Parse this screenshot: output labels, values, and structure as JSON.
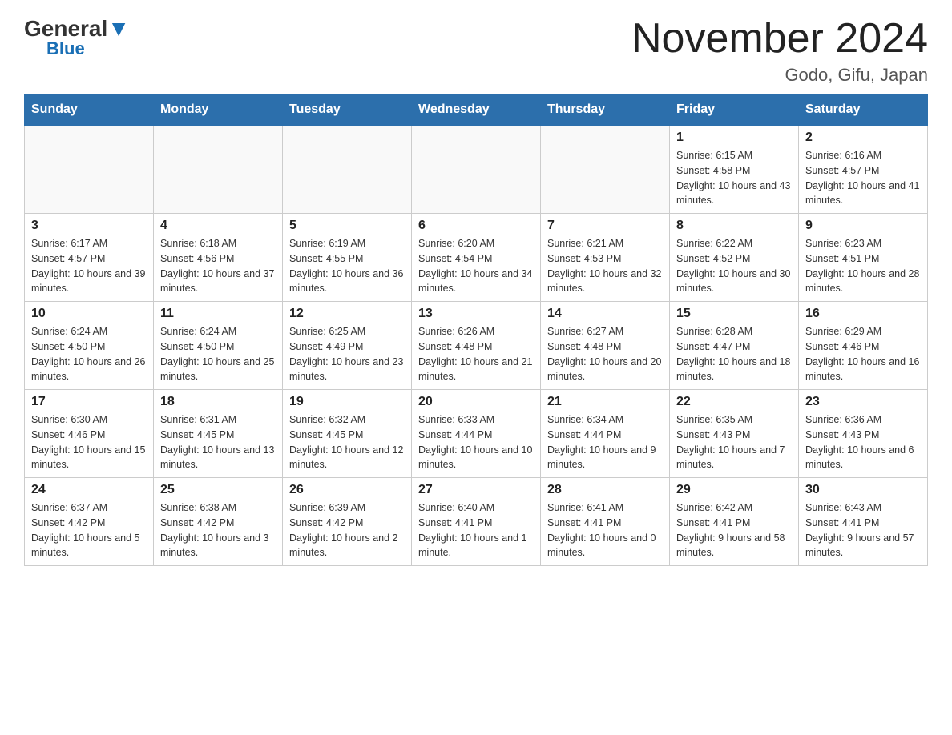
{
  "header": {
    "logo_general": "General",
    "logo_blue": "Blue",
    "month_title": "November 2024",
    "location": "Godo, Gifu, Japan"
  },
  "days_of_week": [
    "Sunday",
    "Monday",
    "Tuesday",
    "Wednesday",
    "Thursday",
    "Friday",
    "Saturday"
  ],
  "weeks": [
    [
      {
        "day": "",
        "info": ""
      },
      {
        "day": "",
        "info": ""
      },
      {
        "day": "",
        "info": ""
      },
      {
        "day": "",
        "info": ""
      },
      {
        "day": "",
        "info": ""
      },
      {
        "day": "1",
        "info": "Sunrise: 6:15 AM\nSunset: 4:58 PM\nDaylight: 10 hours and 43 minutes."
      },
      {
        "day": "2",
        "info": "Sunrise: 6:16 AM\nSunset: 4:57 PM\nDaylight: 10 hours and 41 minutes."
      }
    ],
    [
      {
        "day": "3",
        "info": "Sunrise: 6:17 AM\nSunset: 4:57 PM\nDaylight: 10 hours and 39 minutes."
      },
      {
        "day": "4",
        "info": "Sunrise: 6:18 AM\nSunset: 4:56 PM\nDaylight: 10 hours and 37 minutes."
      },
      {
        "day": "5",
        "info": "Sunrise: 6:19 AM\nSunset: 4:55 PM\nDaylight: 10 hours and 36 minutes."
      },
      {
        "day": "6",
        "info": "Sunrise: 6:20 AM\nSunset: 4:54 PM\nDaylight: 10 hours and 34 minutes."
      },
      {
        "day": "7",
        "info": "Sunrise: 6:21 AM\nSunset: 4:53 PM\nDaylight: 10 hours and 32 minutes."
      },
      {
        "day": "8",
        "info": "Sunrise: 6:22 AM\nSunset: 4:52 PM\nDaylight: 10 hours and 30 minutes."
      },
      {
        "day": "9",
        "info": "Sunrise: 6:23 AM\nSunset: 4:51 PM\nDaylight: 10 hours and 28 minutes."
      }
    ],
    [
      {
        "day": "10",
        "info": "Sunrise: 6:24 AM\nSunset: 4:50 PM\nDaylight: 10 hours and 26 minutes."
      },
      {
        "day": "11",
        "info": "Sunrise: 6:24 AM\nSunset: 4:50 PM\nDaylight: 10 hours and 25 minutes."
      },
      {
        "day": "12",
        "info": "Sunrise: 6:25 AM\nSunset: 4:49 PM\nDaylight: 10 hours and 23 minutes."
      },
      {
        "day": "13",
        "info": "Sunrise: 6:26 AM\nSunset: 4:48 PM\nDaylight: 10 hours and 21 minutes."
      },
      {
        "day": "14",
        "info": "Sunrise: 6:27 AM\nSunset: 4:48 PM\nDaylight: 10 hours and 20 minutes."
      },
      {
        "day": "15",
        "info": "Sunrise: 6:28 AM\nSunset: 4:47 PM\nDaylight: 10 hours and 18 minutes."
      },
      {
        "day": "16",
        "info": "Sunrise: 6:29 AM\nSunset: 4:46 PM\nDaylight: 10 hours and 16 minutes."
      }
    ],
    [
      {
        "day": "17",
        "info": "Sunrise: 6:30 AM\nSunset: 4:46 PM\nDaylight: 10 hours and 15 minutes."
      },
      {
        "day": "18",
        "info": "Sunrise: 6:31 AM\nSunset: 4:45 PM\nDaylight: 10 hours and 13 minutes."
      },
      {
        "day": "19",
        "info": "Sunrise: 6:32 AM\nSunset: 4:45 PM\nDaylight: 10 hours and 12 minutes."
      },
      {
        "day": "20",
        "info": "Sunrise: 6:33 AM\nSunset: 4:44 PM\nDaylight: 10 hours and 10 minutes."
      },
      {
        "day": "21",
        "info": "Sunrise: 6:34 AM\nSunset: 4:44 PM\nDaylight: 10 hours and 9 minutes."
      },
      {
        "day": "22",
        "info": "Sunrise: 6:35 AM\nSunset: 4:43 PM\nDaylight: 10 hours and 7 minutes."
      },
      {
        "day": "23",
        "info": "Sunrise: 6:36 AM\nSunset: 4:43 PM\nDaylight: 10 hours and 6 minutes."
      }
    ],
    [
      {
        "day": "24",
        "info": "Sunrise: 6:37 AM\nSunset: 4:42 PM\nDaylight: 10 hours and 5 minutes."
      },
      {
        "day": "25",
        "info": "Sunrise: 6:38 AM\nSunset: 4:42 PM\nDaylight: 10 hours and 3 minutes."
      },
      {
        "day": "26",
        "info": "Sunrise: 6:39 AM\nSunset: 4:42 PM\nDaylight: 10 hours and 2 minutes."
      },
      {
        "day": "27",
        "info": "Sunrise: 6:40 AM\nSunset: 4:41 PM\nDaylight: 10 hours and 1 minute."
      },
      {
        "day": "28",
        "info": "Sunrise: 6:41 AM\nSunset: 4:41 PM\nDaylight: 10 hours and 0 minutes."
      },
      {
        "day": "29",
        "info": "Sunrise: 6:42 AM\nSunset: 4:41 PM\nDaylight: 9 hours and 58 minutes."
      },
      {
        "day": "30",
        "info": "Sunrise: 6:43 AM\nSunset: 4:41 PM\nDaylight: 9 hours and 57 minutes."
      }
    ]
  ]
}
